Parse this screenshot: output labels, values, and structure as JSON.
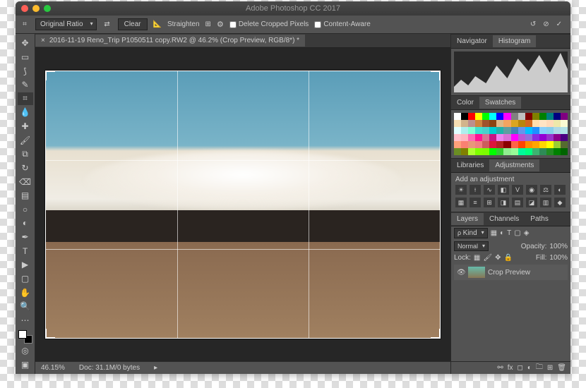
{
  "window": {
    "title": "Adobe Photoshop CC 2017"
  },
  "optionsBar": {
    "ratioPreset": "Original Ratio",
    "clear": "Clear",
    "straighten": "Straighten",
    "deleteCropped": "Delete Cropped Pixels",
    "contentAware": "Content-Aware"
  },
  "document": {
    "tabTitle": "2016-11-19 Reno_Trip P1050511 copy.RW2 @ 46.2% (Crop Preview, RGB/8*) *"
  },
  "status": {
    "zoom": "46.15%",
    "docInfo": "Doc: 31.1M/0 bytes"
  },
  "panels": {
    "navigator": {
      "tab1": "Navigator",
      "tab2": "Histogram"
    },
    "color": {
      "tab1": "Color",
      "tab2": "Swatches"
    },
    "libraries": {
      "tab1": "Libraries",
      "tab2": "Adjustments",
      "addLabel": "Add an adjustment"
    },
    "layers": {
      "tab1": "Layers",
      "tab2": "Channels",
      "tab3": "Paths",
      "filterKind": "Kind",
      "blendMode": "Normal",
      "opacityLabel": "Opacity:",
      "opacityValue": "100%",
      "lockLabel": "Lock:",
      "fillLabel": "Fill:",
      "fillValue": "100%",
      "layerName": "Crop Preview"
    }
  },
  "swatchColors": [
    "#ffffff",
    "#000000",
    "#ff0000",
    "#ffff00",
    "#00ff00",
    "#00ffff",
    "#0000ff",
    "#ff00ff",
    "#808080",
    "#c0c0c0",
    "#800000",
    "#808000",
    "#008000",
    "#008080",
    "#000080",
    "#800080",
    "#f5deb3",
    "#d2b48c",
    "#bc8f8f",
    "#cd853f",
    "#a0522d",
    "#8b4513",
    "#deb887",
    "#f4a460",
    "#daa520",
    "#b8860b",
    "#d2691e",
    "#ffdead",
    "#ffe4c4",
    "#ffdab9",
    "#eee8aa",
    "#fafad2",
    "#e0ffff",
    "#afeeee",
    "#7fffd4",
    "#40e0d0",
    "#48d1cc",
    "#00ced1",
    "#20b2aa",
    "#5f9ea0",
    "#4682b4",
    "#6495ed",
    "#00bfff",
    "#1e90ff",
    "#87cefa",
    "#87ceeb",
    "#add8e6",
    "#b0e0e6",
    "#ffc0cb",
    "#ffb6c1",
    "#ff69b4",
    "#ff1493",
    "#db7093",
    "#c71585",
    "#ee82ee",
    "#da70d6",
    "#ff00ff",
    "#ba55d3",
    "#9370db",
    "#8a2be2",
    "#9400d3",
    "#9932cc",
    "#8b008b",
    "#4b0082",
    "#ffa07a",
    "#fa8072",
    "#e9967a",
    "#f08080",
    "#cd5c5c",
    "#dc143c",
    "#b22222",
    "#8b0000",
    "#ff6347",
    "#ff4500",
    "#ff8c00",
    "#ffa500",
    "#ffd700",
    "#ffff00",
    "#9acd32",
    "#556b2f",
    "#6b8e23",
    "#808000",
    "#adff2f",
    "#7fff00",
    "#7cfc00",
    "#00ff00",
    "#32cd32",
    "#90ee90",
    "#98fb98",
    "#00fa9a",
    "#00ff7f",
    "#3cb371",
    "#2e8b57",
    "#228b22",
    "#008000",
    "#006400"
  ]
}
